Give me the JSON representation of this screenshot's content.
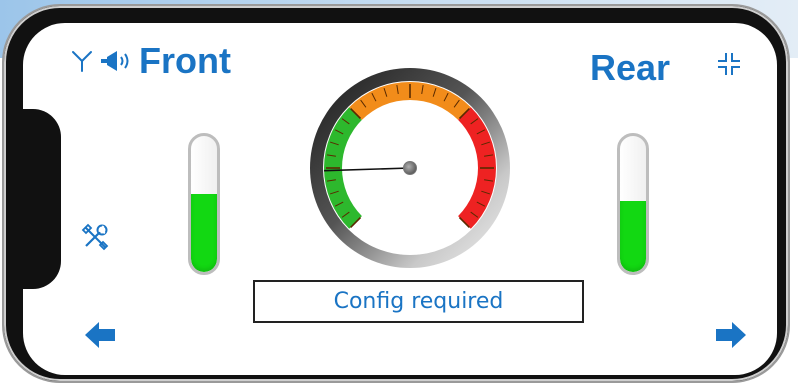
{
  "header": {
    "front_label": "Front",
    "rear_label": "Rear"
  },
  "icons": {
    "signal": "antenna-icon",
    "speaker": "speaker-icon",
    "collapse": "collapse-icon",
    "tools": "tools-icon",
    "prev": "arrow-left-icon",
    "next": "arrow-right-icon"
  },
  "levels": {
    "front_fraction": 0.57,
    "rear_fraction": 0.52
  },
  "gauge": {
    "needle_fraction": 0.16,
    "zones": [
      "green",
      "orange",
      "red"
    ]
  },
  "status": {
    "text": "Config required"
  },
  "colors": {
    "accent": "#1a74c4",
    "level_fill": "#12d812",
    "gauge_green": "#2db82d",
    "gauge_orange": "#f28c1a",
    "gauge_red": "#ee2222"
  }
}
